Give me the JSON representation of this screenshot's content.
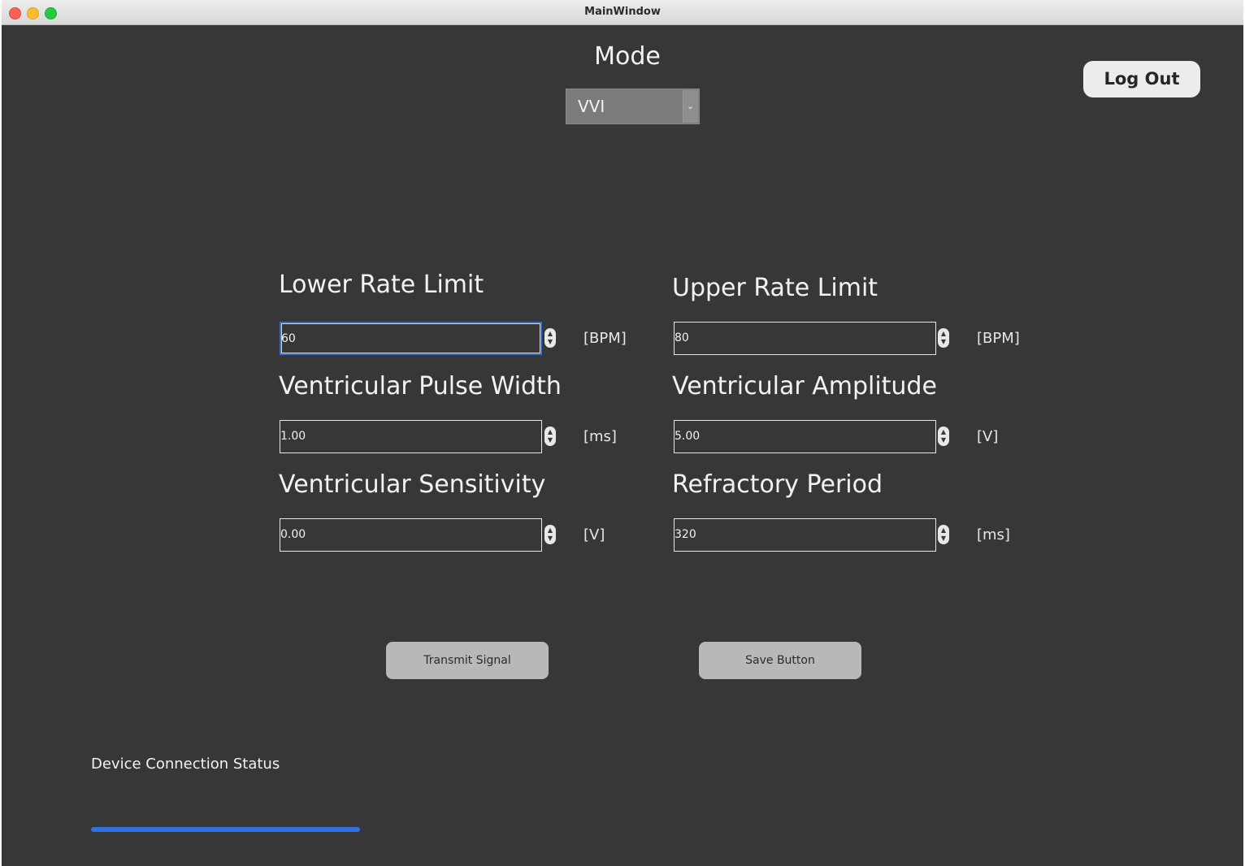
{
  "window": {
    "title": "MainWindow"
  },
  "mode": {
    "label": "Mode",
    "selected": "VVI"
  },
  "logout_label": "Log Out",
  "params": {
    "lower_rate_limit": {
      "label": "Lower Rate Limit",
      "value": "60",
      "unit": "[BPM]"
    },
    "upper_rate_limit": {
      "label": "Upper Rate Limit",
      "value": "80",
      "unit": "[BPM]"
    },
    "ventricular_pulse_width": {
      "label": "Ventricular Pulse Width",
      "value": "1.00",
      "unit": "[ms]"
    },
    "ventricular_amplitude": {
      "label": "Ventricular Amplitude",
      "value": "5.00",
      "unit": "[V]"
    },
    "ventricular_sensitivity": {
      "label": "Ventricular Sensitivity",
      "value": "0.00",
      "unit": "[V]"
    },
    "refractory_period": {
      "label": "Refractory Period",
      "value": "320",
      "unit": "[ms]"
    }
  },
  "actions": {
    "transmit_label": "Transmit Signal",
    "save_label": "Save Button"
  },
  "status": {
    "label": "Device Connection Status",
    "progress": 1.0
  },
  "colors": {
    "background": "#373737",
    "accent": "#2e72e6",
    "button": "#b8b8b8"
  },
  "icons": {
    "dropdown": "chevron-down-icon",
    "spin": "up-down-arrows-icon"
  }
}
